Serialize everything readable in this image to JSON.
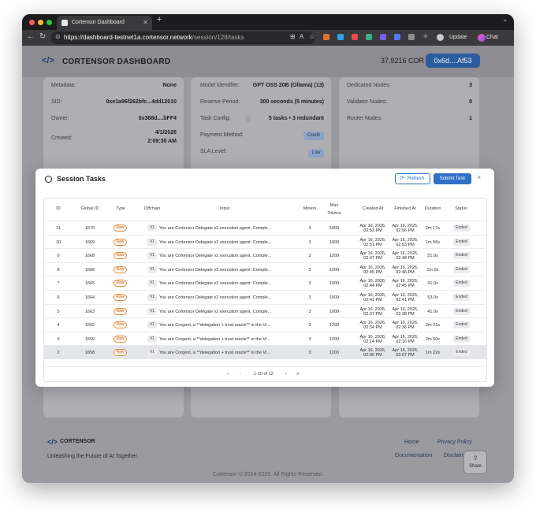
{
  "browser": {
    "tab_title": "Cortensor Dashboard",
    "url_host": "https://dashboard-testnet1a.cortensor.network",
    "url_path": "/session/128/tasks",
    "update_label": "Update",
    "chat_label": "Chat"
  },
  "header": {
    "logo": "</>",
    "title": "CORTENSOR DASHBOARD",
    "balance": "37.9216 COR",
    "wallet": "0x6d....Af53"
  },
  "session_info": {
    "left": [
      {
        "label": "Metadata:",
        "value": "None"
      },
      {
        "label": "SID:",
        "value": "0xe1a96f262bfc...4dd12010"
      },
      {
        "label": "Owner:",
        "value": "0x368d....bFF4"
      },
      {
        "label": "Created:",
        "value": "4/1/2026",
        "value2": "2:09:30 AM"
      }
    ],
    "middle": [
      {
        "label": "Model Identifier:",
        "value": "GPT OSS 20B (Ollama) (13)"
      },
      {
        "label": "Reserve Period:",
        "value": "300 seconds (5 minutes)"
      },
      {
        "label": "Task Config:",
        "value": "5 tasks • 3 redundant"
      },
      {
        "label": "Payment Method:",
        "value": "Credit"
      },
      {
        "label": "SLA Level:",
        "value": "Low"
      }
    ],
    "right": [
      {
        "label": "Dedicated Nodes:",
        "value": "3"
      },
      {
        "label": "Validator Nodes:",
        "value": "0"
      },
      {
        "label": "Router Nodes:",
        "value": "1"
      }
    ]
  },
  "modal": {
    "title": "Session Tasks",
    "refresh_label": "Refresh",
    "submit_label": "Submit Task",
    "close": "×",
    "columns": [
      "ID",
      "Global ID",
      "Type",
      "Offchain",
      "Input",
      "Miners",
      "Max Tokens",
      "Created At",
      "Finished At",
      "Duration",
      "Status"
    ],
    "rows": [
      {
        "id": "11",
        "gid": "1670",
        "type": "Raw",
        "offchain": "V1",
        "input": "You are Cortensor Delegate v2 execution agent. Comple...",
        "miners": "3",
        "tokens": "1000",
        "c1": "Apr 16, 2026,",
        "c2": "02:53 PM",
        "f1": "Apr 16, 2026,",
        "f2": "02:56 PM",
        "duration": "2m 17s",
        "status": "Ended"
      },
      {
        "id": "10",
        "gid": "1669",
        "type": "Raw",
        "offchain": "V1",
        "input": "You are Cortensor Delegate v2 execution agent. Comple...",
        "miners": "3",
        "tokens": "1000",
        "c1": "Apr 16, 2026,",
        "c2": "02:51 PM",
        "f1": "Apr 16, 2026,",
        "f2": "02:53 PM",
        "duration": "1m 56s",
        "status": "Ended"
      },
      {
        "id": "9",
        "gid": "1668",
        "type": "Raw",
        "offchain": "V1",
        "input": "You are Cortensor Delegate v2 execution agent. Comple...",
        "miners": "3",
        "tokens": "1200",
        "c1": "Apr 16, 2026,",
        "c2": "02:47 PM",
        "f1": "Apr 16, 2026,",
        "f2": "02:48 PM",
        "duration": "51.0s",
        "status": "Ended"
      },
      {
        "id": "8",
        "gid": "1666",
        "type": "Raw",
        "offchain": "V1",
        "input": "You are Cortensor Delegate v2 execution agent. Comple...",
        "miners": "3",
        "tokens": "1200",
        "c1": "Apr 16, 2026,",
        "c2": "02:45 PM",
        "f1": "Apr 16, 2026,",
        "f2": "02:46 PM",
        "duration": "1m 9s",
        "status": "Ended"
      },
      {
        "id": "7",
        "gid": "1665",
        "type": "Raw",
        "offchain": "V1",
        "input": "You are Cortensor Delegate v2 execution agent. Comple...",
        "miners": "3",
        "tokens": "1000",
        "c1": "Apr 16, 2026,",
        "c2": "02:44 PM",
        "f1": "Apr 16, 2026,",
        "f2": "02:45 PM",
        "duration": "31.0s",
        "status": "Ended"
      },
      {
        "id": "6",
        "gid": "1664",
        "type": "Raw",
        "offchain": "V1",
        "input": "You are Cortensor Delegate v2 execution agent. Comple...",
        "miners": "3",
        "tokens": "1000",
        "c1": "Apr 16, 2026,",
        "c2": "02:41 PM",
        "f1": "Apr 16, 2026,",
        "f2": "02:41 PM",
        "duration": "53.0s",
        "status": "Ended"
      },
      {
        "id": "5",
        "gid": "1663",
        "type": "Raw",
        "offchain": "V1",
        "input": "You are Cortensor Delegate v2 execution agent. Comple...",
        "miners": "3",
        "tokens": "1000",
        "c1": "Apr 16, 2026,",
        "c2": "02:37 PM",
        "f1": "Apr 16, 2026,",
        "f2": "02:38 PM",
        "duration": "41.0s",
        "status": "Ended"
      },
      {
        "id": "4",
        "gid": "1662",
        "type": "Raw",
        "offchain": "V1",
        "input": "You are Corgent, a **delegation + trust oracle** in the Vi...",
        "miners": "3",
        "tokens": "1200",
        "c1": "Apr 16, 2026,",
        "c2": "02:34 PM",
        "f1": "Apr 16, 2026,",
        "f2": "02:36 PM",
        "duration": "2m 21s",
        "status": "Ended"
      },
      {
        "id": "3",
        "gid": "1659",
        "type": "Raw",
        "offchain": "V1",
        "input": "You are Corgent, a **delegation + trust oracle** in the Vi...",
        "miners": "3",
        "tokens": "1200",
        "c1": "Apr 16, 2026,",
        "c2": "02:14 PM",
        "f1": "Apr 16, 2026,",
        "f2": "02:16 PM",
        "duration": "2m 50s",
        "status": "Ended"
      },
      {
        "id": "2",
        "gid": "1658",
        "type": "Raw",
        "offchain": "V1",
        "input": "You are Corgent, a **delegation + trust oracle** in the Vi...",
        "miners": "3",
        "tokens": "1200",
        "c1": "Apr 16, 2026,",
        "c2": "02:06 PM",
        "f1": "Apr 16, 2026,",
        "f2": "02:07 PM",
        "duration": "1m 22s",
        "status": "Ended"
      }
    ],
    "pagination": {
      "first": "«",
      "prev": "‹",
      "info": "1-10 of 12",
      "next": "›",
      "last": "»"
    }
  },
  "footer": {
    "logo": "</>",
    "brand": "CORTENSOR",
    "tagline": "Unleashing the Future of AI Together.",
    "links": [
      "Home",
      "Privacy Policy",
      "Documentation",
      "Disclaim"
    ],
    "copyright": "Cortensor © 2024-2026. All Rights Reserved.",
    "share_label": "Share"
  }
}
